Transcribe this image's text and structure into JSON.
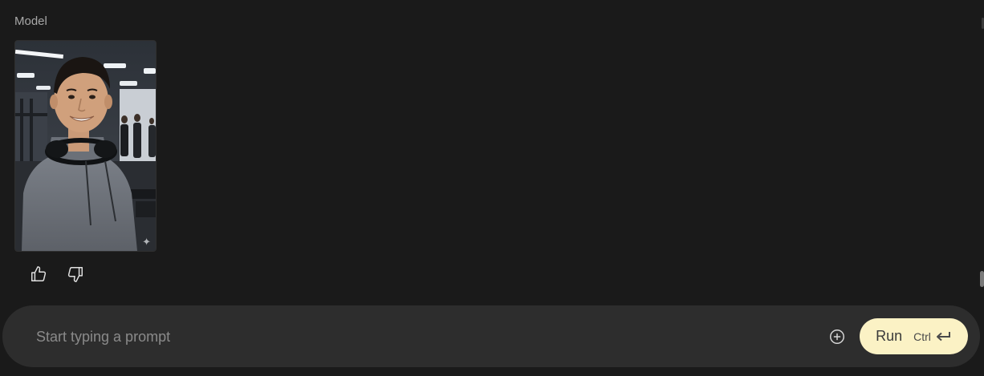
{
  "message": {
    "role_label": "Model",
    "image_icon": "sparkle-icon"
  },
  "feedback": {
    "like_icon": "thumbs-up-icon",
    "dislike_icon": "thumbs-down-icon"
  },
  "composer": {
    "placeholder": "Start typing a prompt",
    "value": "",
    "add_icon": "plus-circle-icon",
    "run_label": "Run",
    "shortcut_key": "Ctrl",
    "shortcut_icon": "enter-icon"
  },
  "colors": {
    "background": "#1a1a1a",
    "composer_bg": "#2d2d2d",
    "run_button_bg": "#fbf2c5"
  }
}
